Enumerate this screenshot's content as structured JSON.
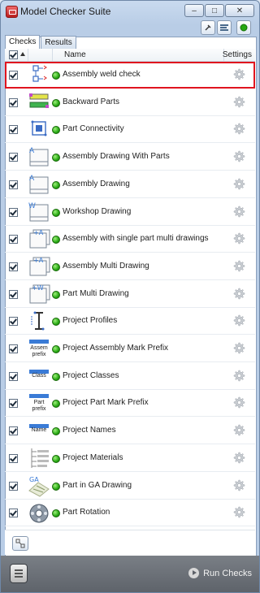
{
  "window": {
    "title": "Model Checker Suite"
  },
  "window_buttons": [
    "–",
    "□",
    "✕"
  ],
  "tabs": [
    {
      "label": "Checks",
      "active": true
    },
    {
      "label": "Results",
      "active": false
    }
  ],
  "table": {
    "columns": {
      "name": "Name",
      "settings": "Settings"
    },
    "rows": [
      {
        "label": "Assembly weld check",
        "checked": true,
        "icon": "weld-check-icon",
        "selected": true
      },
      {
        "label": "Backward Parts",
        "checked": true,
        "icon": "backward-parts-icon"
      },
      {
        "label": "Part Connectivity",
        "checked": true,
        "icon": "part-connectivity-icon"
      },
      {
        "label": "Assembly Drawing With Parts",
        "checked": true,
        "icon": "drawing-a-icon"
      },
      {
        "label": "Assembly Drawing",
        "checked": true,
        "icon": "drawing-a-icon"
      },
      {
        "label": "Workshop Drawing",
        "checked": true,
        "icon": "drawing-w-icon"
      },
      {
        "label": "Assembly with single part multi drawings",
        "checked": true,
        "icon": "multi-drawing-a-icon"
      },
      {
        "label": "Assembly Multi Drawing",
        "checked": true,
        "icon": "multi-drawing-a-icon"
      },
      {
        "label": "Part Multi Drawing",
        "checked": true,
        "icon": "multi-drawing-w-icon"
      },
      {
        "label": "Project Profiles",
        "checked": true,
        "icon": "profile-icon"
      },
      {
        "label": "Project Assembly Mark Prefix",
        "checked": true,
        "icon": "assem-prefix-icon",
        "icon_text": "Assem prefix"
      },
      {
        "label": "Project Classes",
        "checked": true,
        "icon": "class-icon",
        "icon_text": "Class"
      },
      {
        "label": "Project Part Mark Prefix",
        "checked": true,
        "icon": "part-prefix-icon",
        "icon_text": "Part prefix"
      },
      {
        "label": "Project Names",
        "checked": true,
        "icon": "name-icon",
        "icon_text": "Name"
      },
      {
        "label": "Project Materials",
        "checked": true,
        "icon": "materials-icon"
      },
      {
        "label": "Part in GA Drawing",
        "checked": true,
        "icon": "ga-drawing-icon"
      },
      {
        "label": "Part Rotation",
        "checked": true,
        "icon": "part-rotation-icon"
      }
    ]
  },
  "footer": {
    "run_label": "Run Checks"
  },
  "colors": {
    "selection_outline": "#e0151f",
    "status_ok": "#27a813",
    "footer_bg": "#676c73"
  }
}
